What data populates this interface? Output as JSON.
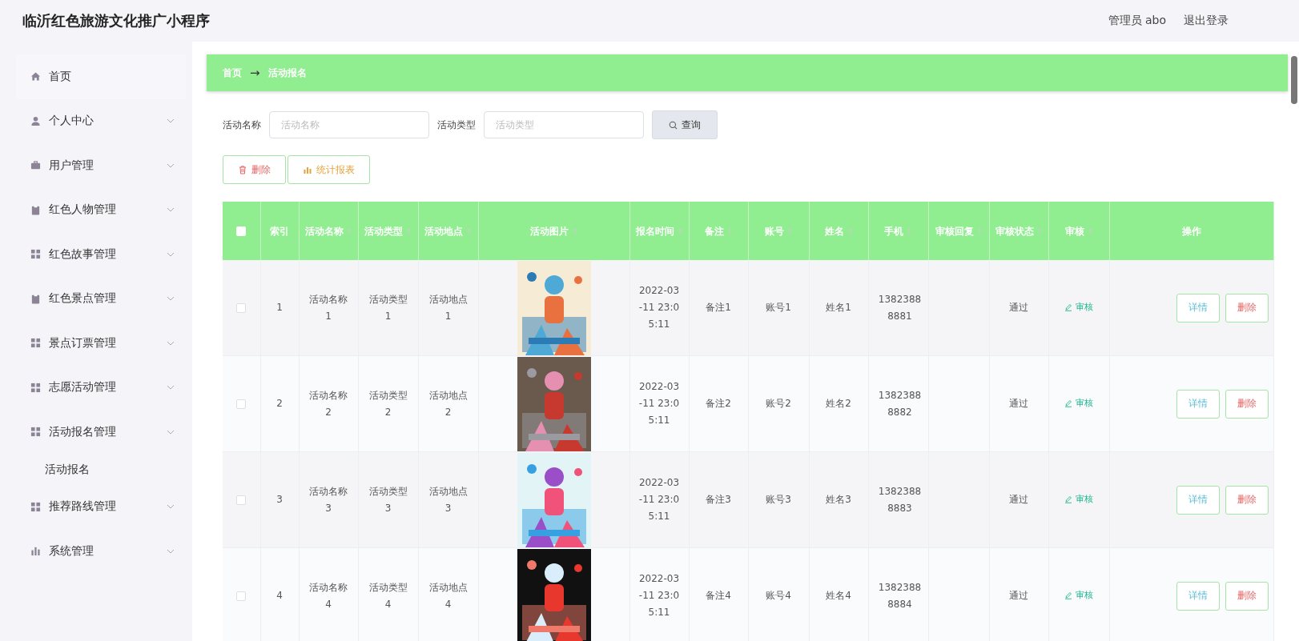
{
  "app": {
    "title": "临沂红色旅游文化推广小程序"
  },
  "user": {
    "role_name": "管理员 abo",
    "logout": "退出登录"
  },
  "sidebar": {
    "items": [
      {
        "label": "首页"
      },
      {
        "label": "个人中心",
        "expandable": true
      },
      {
        "label": "用户管理",
        "expandable": true
      },
      {
        "label": "红色人物管理",
        "expandable": true
      },
      {
        "label": "红色故事管理",
        "expandable": true
      },
      {
        "label": "红色景点管理",
        "expandable": true
      },
      {
        "label": "景点订票管理",
        "expandable": true
      },
      {
        "label": "志愿活动管理",
        "expandable": true
      },
      {
        "label": "活动报名管理",
        "expandable": true,
        "children": [
          {
            "label": "活动报名"
          }
        ]
      },
      {
        "label": "推荐路线管理",
        "expandable": true
      },
      {
        "label": "系统管理",
        "expandable": true
      }
    ]
  },
  "breadcrumb": {
    "items": [
      "首页",
      "活动报名"
    ],
    "separator": "→"
  },
  "search": {
    "fields": [
      {
        "label": "活动名称",
        "placeholder": "活动名称"
      },
      {
        "label": "活动类型",
        "placeholder": "活动类型"
      }
    ],
    "button": "查询"
  },
  "actions": [
    {
      "kind": "delete",
      "label": "删除"
    },
    {
      "kind": "report",
      "label": "统计报表"
    }
  ],
  "table": {
    "header_checked": false,
    "columns": [
      {
        "label": "索引",
        "sortable": false
      },
      {
        "label": "活动名称",
        "sortable": true
      },
      {
        "label": "活动类型",
        "sortable": true
      },
      {
        "label": "活动地点",
        "sortable": true
      },
      {
        "label": "活动图片",
        "sortable": true
      },
      {
        "label": "报名时间",
        "sortable": true
      },
      {
        "label": "备注",
        "sortable": true
      },
      {
        "label": "账号",
        "sortable": true
      },
      {
        "label": "姓名",
        "sortable": true
      },
      {
        "label": "手机",
        "sortable": true
      },
      {
        "label": "审核回复",
        "sortable": true
      },
      {
        "label": "审核状态",
        "sortable": true
      },
      {
        "label": "审核",
        "sortable": true
      },
      {
        "label": "操作",
        "sortable": false
      }
    ],
    "rows": [
      {
        "checked": false,
        "index": "1",
        "name": "活动名称1",
        "type": "活动类型1",
        "place": "活动地点1",
        "time": "2022-03-11 23:05:11",
        "note": "备注1",
        "account": "账号1",
        "person": "姓名1",
        "phone": "13823888881",
        "status": "通过",
        "review": "审核",
        "buttons": [
          "详情",
          "删除"
        ]
      },
      {
        "checked": false,
        "index": "2",
        "name": "活动名称2",
        "type": "活动类型2",
        "place": "活动地点2",
        "time": "2022-03-11 23:05:11",
        "note": "备注2",
        "account": "账号2",
        "person": "姓名2",
        "phone": "13823888882",
        "status": "通过",
        "review": "审核",
        "buttons": [
          "详情",
          "删除"
        ]
      },
      {
        "checked": false,
        "index": "3",
        "name": "活动名称3",
        "type": "活动类型3",
        "place": "活动地点3",
        "time": "2022-03-11 23:05:11",
        "note": "备注3",
        "account": "账号3",
        "person": "姓名3",
        "phone": "13823888883",
        "status": "通过",
        "review": "审核",
        "buttons": [
          "详情",
          "删除"
        ]
      },
      {
        "checked": false,
        "index": "4",
        "name": "活动名称4",
        "type": "活动类型4",
        "place": "活动地点4",
        "time": "2022-03-11 23:05:11",
        "note": "备注4",
        "account": "账号4",
        "person": "姓名4",
        "phone": "13823888884",
        "status": "通过",
        "review": "审核",
        "buttons": [
          "详情",
          "删除"
        ]
      }
    ]
  }
}
